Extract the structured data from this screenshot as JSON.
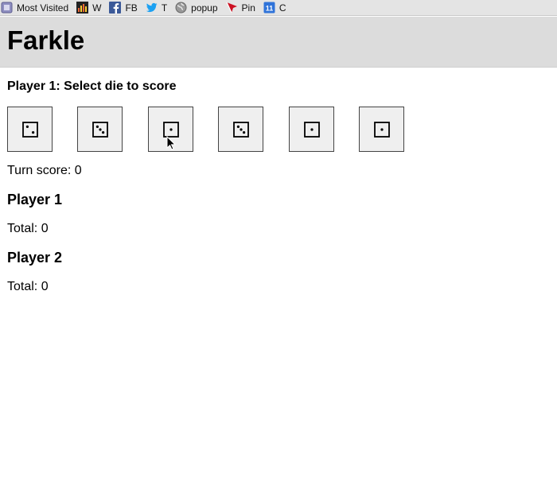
{
  "bookmarks": [
    {
      "label": "Most Visited",
      "icon": "most-visited-icon",
      "color": "#8e8ec0"
    },
    {
      "label": "W",
      "icon": "w-site-icon",
      "color": "#b8860b"
    },
    {
      "label": "FB",
      "icon": "facebook-icon",
      "color": "#3b5998"
    },
    {
      "label": "T",
      "icon": "twitter-icon",
      "color": "#1da1f2"
    },
    {
      "label": "popup",
      "icon": "globe-icon",
      "color": "#777777"
    },
    {
      "label": "Pin",
      "icon": "pin-icon",
      "color": "#cc1122"
    },
    {
      "label": "C",
      "icon": "calendar-icon",
      "color": "#2f73d9"
    }
  ],
  "calendar_icon_text": "11",
  "app": {
    "title": "Farkle",
    "prompt": "Player 1: Select die to score",
    "turn_score_label": "Turn score: 0"
  },
  "dice": [
    2,
    3,
    1,
    3,
    1,
    1
  ],
  "players": [
    {
      "name": "Player 1",
      "total_label": "Total: 0"
    },
    {
      "name": "Player 2",
      "total_label": "Total: 0"
    }
  ],
  "colors": {
    "header_bg": "#dcdcdc",
    "die_bg": "#efefef",
    "bookmarks_bg": "#e4e4e4"
  }
}
